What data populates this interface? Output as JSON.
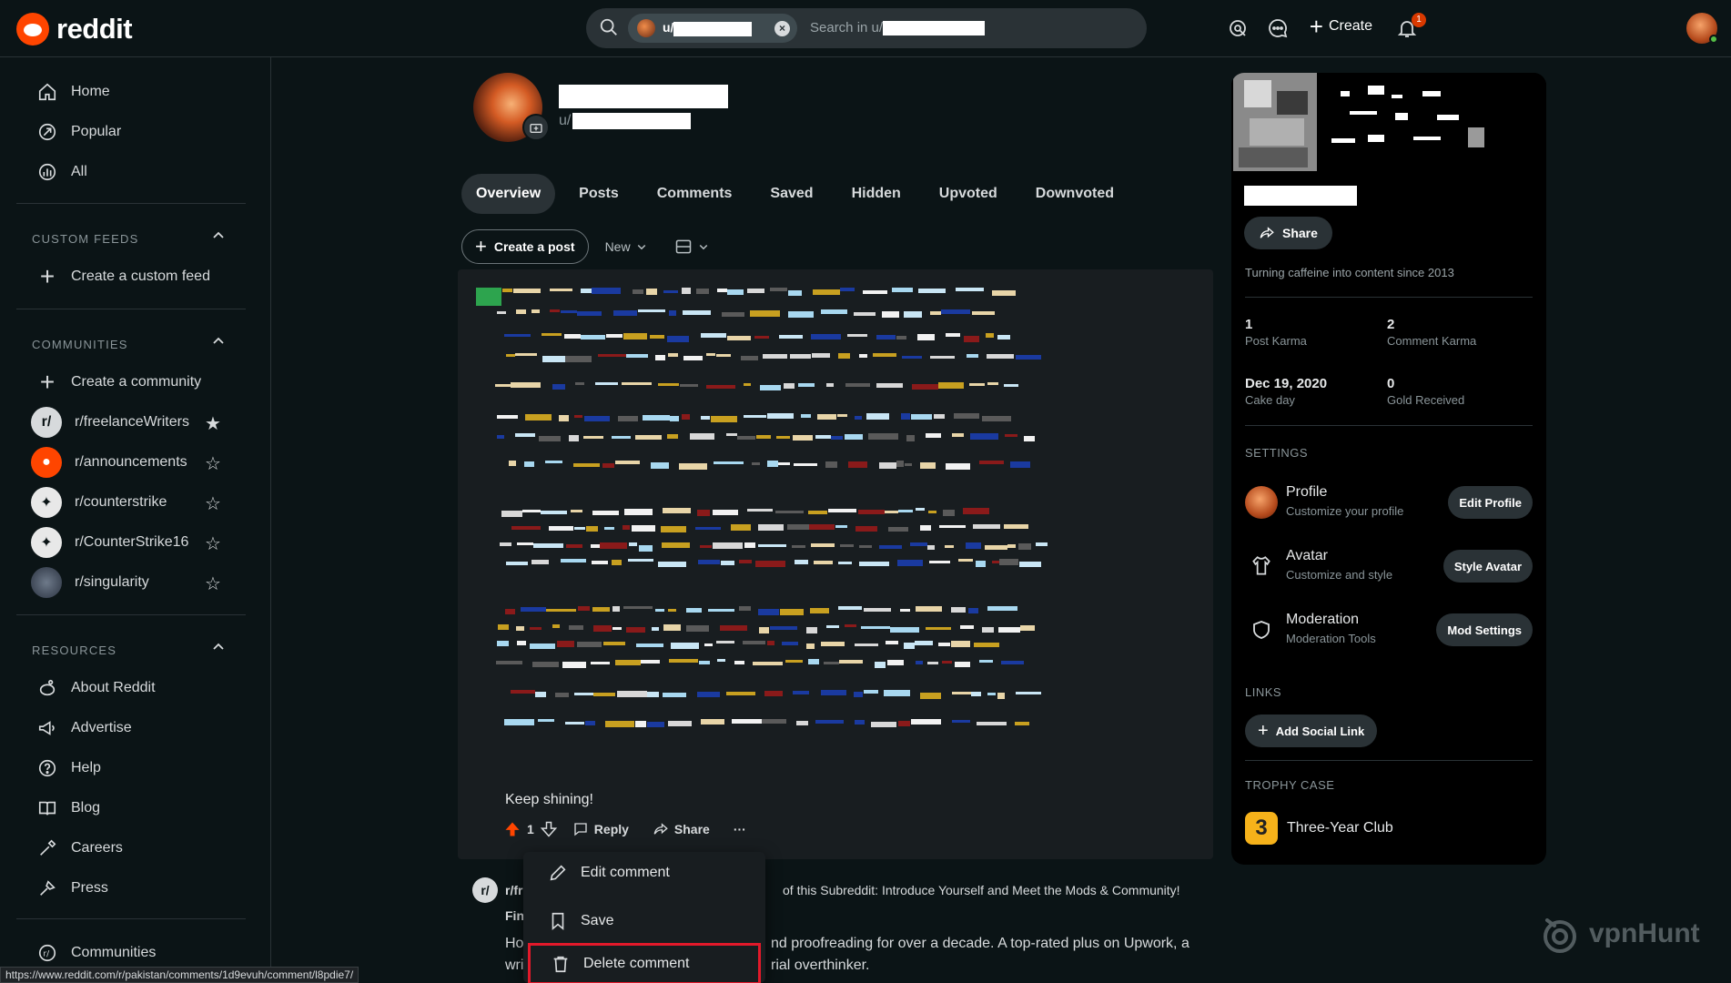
{
  "brand": {
    "name": "reddit",
    "accent": "#ff4500"
  },
  "search": {
    "chip_prefix": "u/",
    "placeholder_prefix": "Search in u/"
  },
  "header": {
    "create_label": "Create",
    "notification_count": "1"
  },
  "sidebar": {
    "main": [
      {
        "label": "Home",
        "icon": "home-icon"
      },
      {
        "label": "Popular",
        "icon": "popular-icon"
      },
      {
        "label": "All",
        "icon": "all-icon"
      }
    ],
    "custom_feeds_title": "CUSTOM FEEDS",
    "create_feed": "Create a custom feed",
    "communities_title": "COMMUNITIES",
    "create_community": "Create a community",
    "communities": [
      {
        "name": "r/freelanceWriters",
        "starred": true
      },
      {
        "name": "r/announcements",
        "starred": false
      },
      {
        "name": "r/counterstrike",
        "starred": false
      },
      {
        "name": "r/CounterStrike16",
        "starred": false
      },
      {
        "name": "r/singularity",
        "starred": false
      }
    ],
    "resources_title": "RESOURCES",
    "resources": [
      {
        "label": "About Reddit",
        "icon": "about-icon"
      },
      {
        "label": "Advertise",
        "icon": "advertise-icon"
      },
      {
        "label": "Help",
        "icon": "help-icon"
      },
      {
        "label": "Blog",
        "icon": "blog-icon"
      },
      {
        "label": "Careers",
        "icon": "careers-icon"
      },
      {
        "label": "Press",
        "icon": "press-icon"
      }
    ],
    "communities_link": "Communities"
  },
  "profile": {
    "username_prefix": "u/",
    "tabs": [
      "Overview",
      "Posts",
      "Comments",
      "Saved",
      "Hidden",
      "Upvoted",
      "Downvoted"
    ],
    "active_tab": "Overview"
  },
  "feed": {
    "create_post": "Create a post",
    "sort": "New"
  },
  "comment": {
    "text": "Keep shining!",
    "score": "1",
    "reply": "Reply",
    "share": "Share",
    "more": "···"
  },
  "menu": {
    "items": [
      "Edit comment",
      "Save",
      "Delete comment"
    ]
  },
  "post2": {
    "sub_prefix": "r/fr",
    "title_tail": "of this Subreddit: Introduce Yourself and Meet the Mods & Community!",
    "bold_fragment": "Fin",
    "body_line1_start": "Ho",
    "body_line1_end": "nd proofreading for over a decade. A top-rated plus on Upwork, a",
    "body_line2_start": "wri",
    "body_line2_end": "rial overthinker."
  },
  "right": {
    "share": "Share",
    "bio": "Turning caffeine into content since 2013",
    "stats": [
      {
        "value": "1",
        "label": "Post Karma"
      },
      {
        "value": "2",
        "label": "Comment Karma"
      },
      {
        "value": "Dec 19, 2020",
        "label": "Cake day"
      },
      {
        "value": "0",
        "label": "Gold Received"
      }
    ],
    "settings_title": "SETTINGS",
    "settings": [
      {
        "title": "Profile",
        "sub": "Customize your profile",
        "button": "Edit Profile"
      },
      {
        "title": "Avatar",
        "sub": "Customize and style",
        "button": "Style Avatar"
      },
      {
        "title": "Moderation",
        "sub": "Moderation Tools",
        "button": "Mod Settings"
      }
    ],
    "links_title": "LINKS",
    "add_social": "Add Social Link",
    "trophy_title": "TROPHY CASE",
    "trophy": "Three-Year Club",
    "trophy_glyph": "3"
  },
  "status_url": "https://www.reddit.com/r/pakistan/comments/1d9evuh/comment/l8pdie7/",
  "watermark": "vpnHunt"
}
